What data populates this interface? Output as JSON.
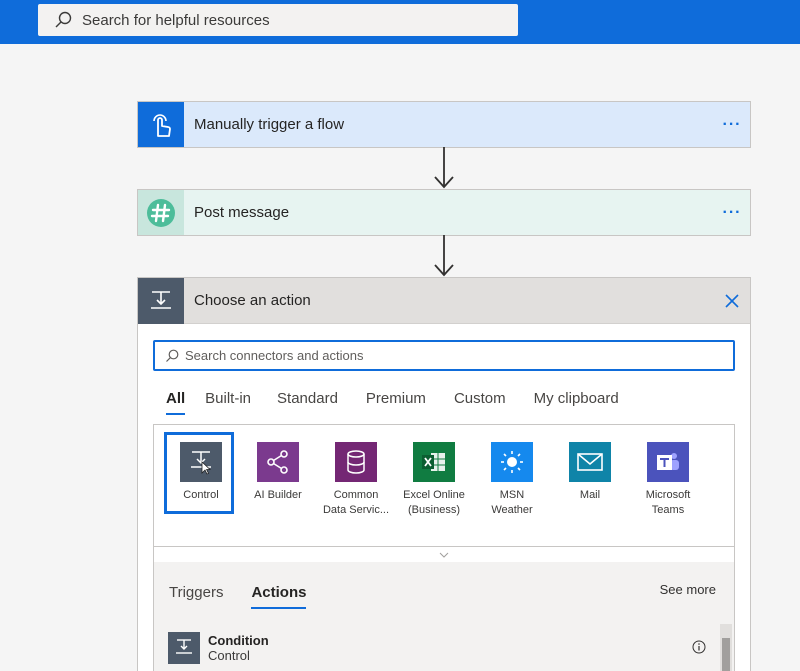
{
  "global_search": {
    "placeholder": "Search for helpful resources"
  },
  "flow": {
    "trigger": {
      "title": "Manually trigger a flow",
      "more": "···"
    },
    "post": {
      "title": "Post message",
      "more": "···"
    }
  },
  "action_panel": {
    "title": "Choose an action",
    "search_placeholder": "Search connectors and actions",
    "tabs": [
      "All",
      "Built-in",
      "Standard",
      "Premium",
      "Custom",
      "My clipboard"
    ],
    "active_tab": "All",
    "connectors": [
      {
        "line1": "Control",
        "line2": "",
        "icon": "control-icon",
        "color": "#4d5a6a"
      },
      {
        "line1": "AI Builder",
        "line2": "",
        "icon": "ai-builder-icon",
        "color": "#7b3a8e"
      },
      {
        "line1": "Common",
        "line2": "Data Servic...",
        "icon": "database-icon",
        "color": "#742774"
      },
      {
        "line1": "Excel Online",
        "line2": "(Business)",
        "icon": "excel-icon",
        "color": "#107c41"
      },
      {
        "line1": "MSN",
        "line2": "Weather",
        "icon": "weather-icon",
        "color": "#1589ee"
      },
      {
        "line1": "Mail",
        "line2": "",
        "icon": "mail-icon",
        "color": "#0f84a8"
      },
      {
        "line1": "Microsoft",
        "line2": "Teams",
        "icon": "teams-icon",
        "color": "#4b53bc"
      }
    ],
    "results": {
      "tabs": [
        "Triggers",
        "Actions"
      ],
      "active_tab": "Actions",
      "see_more": "See more",
      "items": [
        {
          "name": "Condition",
          "connector": "Control"
        }
      ]
    }
  }
}
